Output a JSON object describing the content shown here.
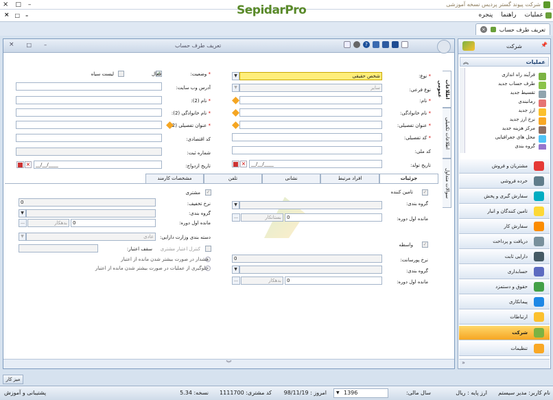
{
  "app": {
    "title": "شرکت پیوند گستر پردیس نسخه آموزشی",
    "logo": "SepidarPro",
    "controls": [
      "×",
      "□",
      "–"
    ]
  },
  "menu": {
    "items": [
      "عملیات",
      "راهنما",
      "پنجره"
    ],
    "mdi_controls": [
      "×",
      "□",
      "–"
    ]
  },
  "doc_tab": {
    "label": "تعریف طرف حساب",
    "close": "×"
  },
  "window": {
    "title": "تعریف طرف حساب",
    "controls": [
      "×",
      "□",
      "–"
    ],
    "help": "?"
  },
  "form": {
    "type_label": "نوع:",
    "type_value": "شخص حقیقی",
    "status_label": "وضعیت:",
    "active_label": "فعال",
    "blacklist_label": "لیست سیاه",
    "subtype_label": "نوع فرعی:",
    "subtype_value": "سایر",
    "website_label": "آدرس وب سایت:",
    "name_label": "نام:",
    "name2_label": "نام (2):",
    "family_label": "نام خانوادگی:",
    "family2_label": "نام خانوادگی (2):",
    "detail_title_label": "عنوان تفصیلی:",
    "detail_title2_label": "عنوان تفصیلی (2):",
    "detail_code_label": "کد تفصیلی:",
    "econ_code_label": "کد اقتصادی:",
    "national_code_label": "کد ملی:",
    "reg_no_label": "شماره ثبت:",
    "birth_label": "تاریخ تولد:",
    "marriage_label": "تاریخ ازدواج:",
    "date_placeholder": "__/__/____"
  },
  "tabs": [
    "جزئیات",
    "افراد مرتبط",
    "نشانی",
    "تلفن",
    "مشخصات کارمند"
  ],
  "side_tabs": [
    "اطلاعات عمومی",
    "اطلاعات تکمیلی",
    "سوالات متداول"
  ],
  "details": {
    "supplier_label": "تامین کننده",
    "group_label": "گروه بندی:",
    "opening_label": "مانده اول دوره:",
    "opening_value": "0",
    "debtor": "بستانکار",
    "broker_label": "واسطه",
    "commission_label": "نرخ پورسانت:",
    "commission_value": "0",
    "group2_label": "گروه بندی:",
    "opening2_label": "مانده اول دوره:",
    "opening2_value": "0",
    "debtor2": "بدهکار",
    "customer_label": "مشتری",
    "discount_label": "نرخ تخفیف:",
    "discount_value": "0",
    "cust_group_label": "گروه بندی:",
    "cust_opening_label": "مانده اول دوره:",
    "cust_opening_value": "0",
    "cust_debtor": "بدهکار",
    "finance_cat_label": "دسته بندی وزارت دارایی:",
    "finance_cat_value": "عادی",
    "credit_check_label": "کنترل اعتبار مشتری",
    "credit_cap_label": "سقف اعتبار:",
    "warn_label": "هشدار در صورت بیشتر شدن مانده از اعتبار",
    "block_label": "جلوگیری از عملیات در صورت بیشتر شدن مانده از اعتبار"
  },
  "right_panel": {
    "header": "شرکت",
    "ops_title": "عملیات",
    "ops": [
      "فرآیند راه اندازی",
      "طرف حساب جدید",
      "تقسیط جدید",
      "رمانبندی",
      "ارز جدید",
      "نرخ ارز جدید",
      "مرکز هزینه جدید",
      "محل های جغرافیایی",
      "گروه بندی"
    ],
    "nav": [
      "مشتریان و فروش",
      "خرده فروشی",
      "سفارش گیری و پخش",
      "تامین کنندگان و انبار",
      "سفارش کار",
      "دریافت و پرداخت",
      "دارایی ثابت",
      "حسابداری",
      "حقوق و دستمزد",
      "پیمانکاری",
      "ارتباطات",
      "شرکت",
      "تنظیمات"
    ],
    "active": "شرکت"
  },
  "taskbar": {
    "button": "میز کار"
  },
  "status": {
    "user_label": "نام کاربر:",
    "user": "مدیر سیستم",
    "base_currency_label": "ارز پایه :",
    "base_currency": "ریال",
    "fiscal_label": "سال مالی:",
    "fiscal": "1396",
    "today_label": "امروز :",
    "today": "98/11/19",
    "customer_code_label": "کد مشتری:",
    "customer_code": "1111700",
    "version_label": "نسخه:",
    "version": "5.34",
    "support": "پشتیبانی و آموزش"
  },
  "colors": {
    "accent": "#f6a623",
    "required_field": "#ffee7a",
    "frame": "#7f9cbf"
  }
}
